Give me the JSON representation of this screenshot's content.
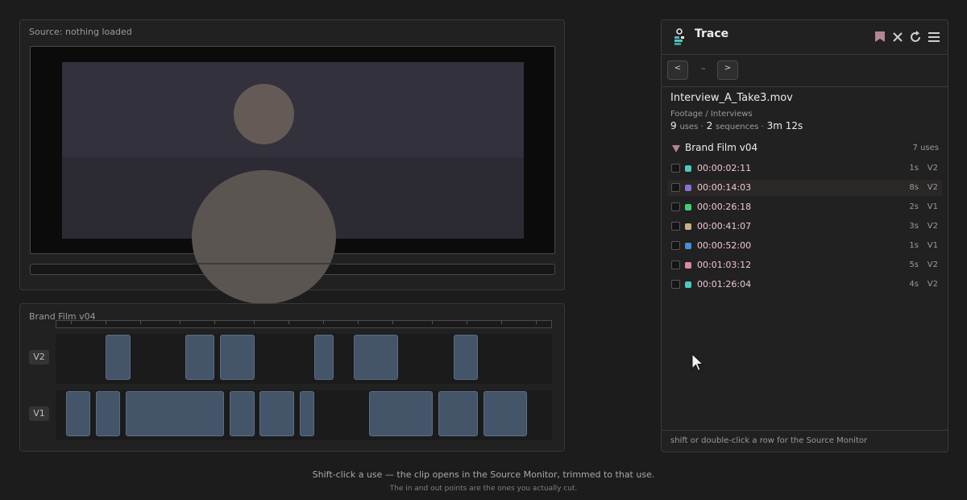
{
  "source_monitor": {
    "title": "Source: nothing loaded"
  },
  "timeline": {
    "title": "Brand Film v04",
    "tracks": [
      {
        "label": "V2",
        "clips": [
          {
            "start": 130,
            "end": 161
          },
          {
            "start": 229,
            "end": 265
          },
          {
            "start": 272,
            "end": 315
          },
          {
            "start": 389,
            "end": 413
          },
          {
            "start": 438,
            "end": 493
          },
          {
            "start": 562,
            "end": 592
          }
        ]
      },
      {
        "label": "V1",
        "clips": [
          {
            "start": 81,
            "end": 111
          },
          {
            "start": 118,
            "end": 148
          },
          {
            "start": 155,
            "end": 277
          },
          {
            "start": 284,
            "end": 315
          },
          {
            "start": 321,
            "end": 364
          },
          {
            "start": 371,
            "end": 389
          },
          {
            "start": 457,
            "end": 536
          },
          {
            "start": 543,
            "end": 592
          },
          {
            "start": 599,
            "end": 653
          }
        ]
      }
    ]
  },
  "trace": {
    "title": "Trace",
    "nav": {
      "prev_label": "<",
      "next_label": ">",
      "separator": "–"
    },
    "clip": {
      "name": "Interview_A_Take3.mov",
      "path": "Footage / Interviews",
      "uses_count": "9",
      "uses_label": "uses ·",
      "sequences_count": "2",
      "sequences_label": "sequences ·",
      "duration": "3m 12s"
    },
    "sequence": {
      "name": "Brand Film v04",
      "uses": "7 uses",
      "rows": [
        {
          "timecode": "00:00:02:11",
          "duration": "1s",
          "track": "V2",
          "color": "#4ec9b8",
          "highlight": false
        },
        {
          "timecode": "00:00:14:03",
          "duration": "8s",
          "track": "V2",
          "color": "#8a6fd8",
          "highlight": true
        },
        {
          "timecode": "00:00:26:18",
          "duration": "2s",
          "track": "V1",
          "color": "#3ecf7a",
          "highlight": false
        },
        {
          "timecode": "00:00:41:07",
          "duration": "3s",
          "track": "V2",
          "color": "#c9b08a",
          "highlight": false
        },
        {
          "timecode": "00:00:52:00",
          "duration": "1s",
          "track": "V1",
          "color": "#4a8fd0",
          "highlight": false
        },
        {
          "timecode": "00:01:03:12",
          "duration": "5s",
          "track": "V2",
          "color": "#d88a9e",
          "highlight": false
        },
        {
          "timecode": "00:01:26:04",
          "duration": "4s",
          "track": "V2",
          "color": "#4ec9b8",
          "highlight": false
        }
      ]
    },
    "footer": "shift or double-click a row for the Source Monitor"
  },
  "captions": {
    "main": "Shift-click a use — the clip opens in the Source Monitor, trimmed to that use.",
    "sub": "The in and out points are the ones you actually cut."
  },
  "colors": {
    "accent_pink": "#b78491",
    "clip_fill": "#44556a"
  }
}
